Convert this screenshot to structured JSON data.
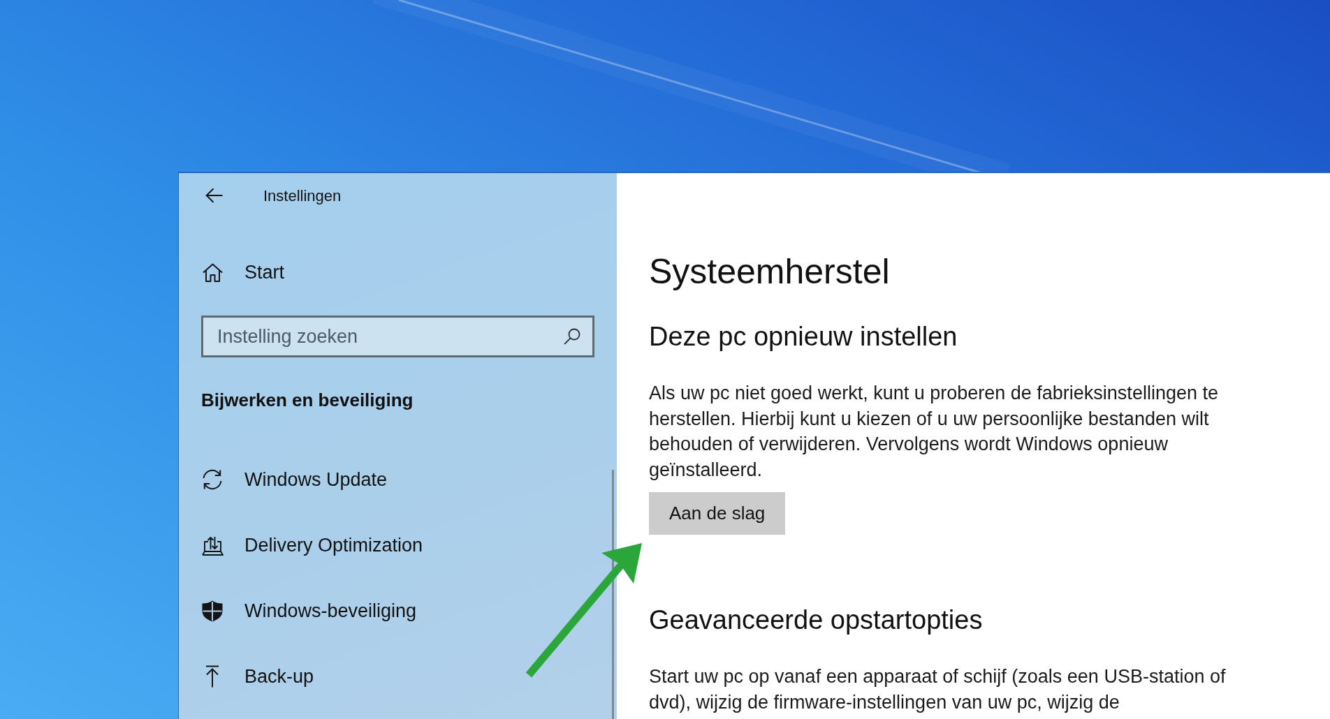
{
  "window": {
    "title": "Instellingen"
  },
  "sidebar": {
    "home": {
      "label": "Start"
    },
    "search": {
      "placeholder": "Instelling zoeken"
    },
    "section_title": "Bijwerken en beveiliging",
    "items": [
      {
        "label": "Windows Update"
      },
      {
        "label": "Delivery Optimization"
      },
      {
        "label": "Windows-beveiliging"
      },
      {
        "label": "Back-up"
      }
    ]
  },
  "content": {
    "title": "Systeemherstel",
    "sections": [
      {
        "heading": "Deze pc opnieuw instellen",
        "text": "Als uw pc niet goed werkt, kunt u proberen de fabrieksinstellingen te herstellen. Hierbij kunt u kiezen of u uw persoonlijke bestanden wilt behouden of verwijderen. Vervolgens wordt Windows opnieuw geïnstalleerd.",
        "button": "Aan de slag"
      },
      {
        "heading": "Geavanceerde opstartopties",
        "text": "Start uw pc op vanaf een apparaat of schijf (zoals een USB-station of dvd), wijzig de firmware-instellingen van uw pc, wijzig de"
      }
    ]
  }
}
